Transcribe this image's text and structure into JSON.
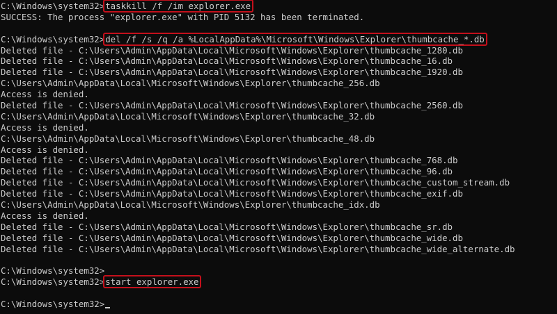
{
  "console": {
    "prompt": "C:\\Windows\\system32>",
    "lines": [
      {
        "kind": "cmd",
        "text": "taskkill /f /im explorer.exe",
        "highlight": true
      },
      {
        "kind": "out",
        "text": "SUCCESS: The process \"explorer.exe\" with PID 5132 has been terminated."
      },
      {
        "kind": "blank"
      },
      {
        "kind": "cmd",
        "text": "del /f /s /q /a %LocalAppData%\\Microsoft\\Windows\\Explorer\\thumbcache_*.db",
        "highlight": true
      },
      {
        "kind": "out",
        "text": "Deleted file - C:\\Users\\Admin\\AppData\\Local\\Microsoft\\Windows\\Explorer\\thumbcache_1280.db"
      },
      {
        "kind": "out",
        "text": "Deleted file - C:\\Users\\Admin\\AppData\\Local\\Microsoft\\Windows\\Explorer\\thumbcache_16.db"
      },
      {
        "kind": "out",
        "text": "Deleted file - C:\\Users\\Admin\\AppData\\Local\\Microsoft\\Windows\\Explorer\\thumbcache_1920.db"
      },
      {
        "kind": "out",
        "text": "C:\\Users\\Admin\\AppData\\Local\\Microsoft\\Windows\\Explorer\\thumbcache_256.db"
      },
      {
        "kind": "out",
        "text": "Access is denied."
      },
      {
        "kind": "out",
        "text": "Deleted file - C:\\Users\\Admin\\AppData\\Local\\Microsoft\\Windows\\Explorer\\thumbcache_2560.db"
      },
      {
        "kind": "out",
        "text": "C:\\Users\\Admin\\AppData\\Local\\Microsoft\\Windows\\Explorer\\thumbcache_32.db"
      },
      {
        "kind": "out",
        "text": "Access is denied."
      },
      {
        "kind": "out",
        "text": "C:\\Users\\Admin\\AppData\\Local\\Microsoft\\Windows\\Explorer\\thumbcache_48.db"
      },
      {
        "kind": "out",
        "text": "Access is denied."
      },
      {
        "kind": "out",
        "text": "Deleted file - C:\\Users\\Admin\\AppData\\Local\\Microsoft\\Windows\\Explorer\\thumbcache_768.db"
      },
      {
        "kind": "out",
        "text": "Deleted file - C:\\Users\\Admin\\AppData\\Local\\Microsoft\\Windows\\Explorer\\thumbcache_96.db"
      },
      {
        "kind": "out",
        "text": "Deleted file - C:\\Users\\Admin\\AppData\\Local\\Microsoft\\Windows\\Explorer\\thumbcache_custom_stream.db"
      },
      {
        "kind": "out",
        "text": "Deleted file - C:\\Users\\Admin\\AppData\\Local\\Microsoft\\Windows\\Explorer\\thumbcache_exif.db"
      },
      {
        "kind": "out",
        "text": "C:\\Users\\Admin\\AppData\\Local\\Microsoft\\Windows\\Explorer\\thumbcache_idx.db"
      },
      {
        "kind": "out",
        "text": "Access is denied."
      },
      {
        "kind": "out",
        "text": "Deleted file - C:\\Users\\Admin\\AppData\\Local\\Microsoft\\Windows\\Explorer\\thumbcache_sr.db"
      },
      {
        "kind": "out",
        "text": "Deleted file - C:\\Users\\Admin\\AppData\\Local\\Microsoft\\Windows\\Explorer\\thumbcache_wide.db"
      },
      {
        "kind": "out",
        "text": "Deleted file - C:\\Users\\Admin\\AppData\\Local\\Microsoft\\Windows\\Explorer\\thumbcache_wide_alternate.db"
      },
      {
        "kind": "blank"
      },
      {
        "kind": "cmd",
        "text": ""
      },
      {
        "kind": "cmd",
        "text": "start explorer.exe",
        "highlight": true
      },
      {
        "kind": "blank"
      },
      {
        "kind": "cmd",
        "text": "",
        "cursor": true
      }
    ]
  },
  "colors": {
    "background": "#0c0c0c",
    "foreground": "#cccccc",
    "highlight_border": "#c4101b"
  }
}
